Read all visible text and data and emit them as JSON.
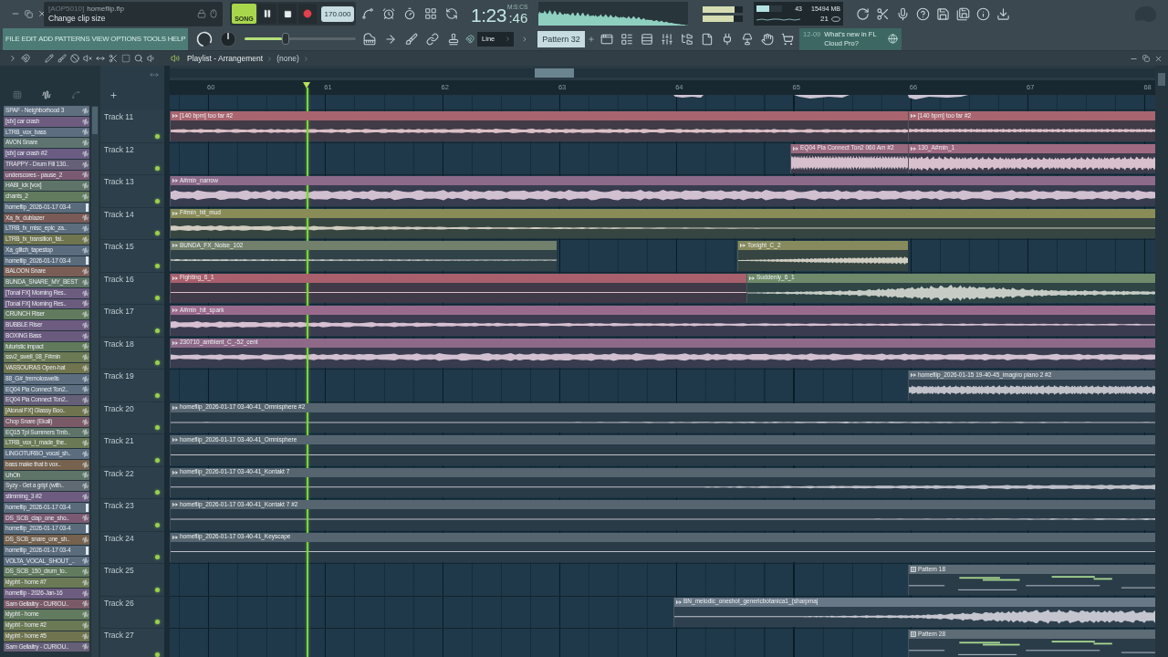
{
  "hint_bar": {
    "tag": "[AOP5010]",
    "file": "homeflip.flp",
    "message": "Change clip size"
  },
  "transport": {
    "mode": "SONG",
    "song_mode": true,
    "playing": true,
    "recording": false,
    "tempo": "170.000"
  },
  "time_display": {
    "main": "1:23",
    "sub": ":46",
    "unit": "M:S:CS"
  },
  "output_meters": [
    {
      "level": 0.8
    },
    {
      "level": 0.78
    }
  ],
  "performance": {
    "cpu": {
      "level": 0.5
    },
    "cpu_reading": "43",
    "memory": "15494 MB",
    "polyphony": "21"
  },
  "menu": [
    "FILE",
    "EDIT",
    "ADD",
    "PATTERNS",
    "VIEW",
    "OPTIONS",
    "TOOLS",
    "HELP"
  ],
  "master_volume": {
    "level": 0.37
  },
  "snap": {
    "value": "Line"
  },
  "pattern_selector": {
    "value": "Pattern 32"
  },
  "news": {
    "date": "12-09",
    "headline": "What's new in FL Cloud Pro?"
  },
  "playlist": {
    "title": "Playlist - Arrangement",
    "arrangement": "(none)",
    "browser_tabs": [
      {
        "kind": "patterns",
        "selected": false
      },
      {
        "kind": "audio",
        "selected": true
      },
      {
        "kind": "automation",
        "selected": false
      }
    ],
    "clip_sources": [
      {
        "name": "SPAF - Neighborhood 3",
        "kind": "audio",
        "color": "#5f6f80"
      },
      {
        "name": "[sfx] car crash",
        "kind": "audio",
        "color": "#6d5c80"
      },
      {
        "name": "LTRB_vox_bass",
        "kind": "audio",
        "color": "#5c6d80"
      },
      {
        "name": "AVON Snare",
        "kind": "audio",
        "color": "#5f7470"
      },
      {
        "name": "[sfx] car crash #2",
        "kind": "audio",
        "color": "#6a5c82"
      },
      {
        "name": "TRAPPY - Drum Fill 130..",
        "kind": "audio",
        "color": "#665f78"
      },
      {
        "name": "underscores - pause_2",
        "kind": "audio",
        "color": "#7a5a72"
      },
      {
        "name": "HABI_ick [vox]",
        "kind": "audio",
        "color": "#5f7468"
      },
      {
        "name": "chants_2",
        "kind": "audio",
        "color": "#627a5e"
      },
      {
        "name": "homeflip_2026-01-17 03-4",
        "kind": "recording",
        "color": "#5a6b7c"
      },
      {
        "name": "Xa_fx_dublazer",
        "kind": "audio",
        "color": "#7a5a56"
      },
      {
        "name": "LTRB_fx_misc_epic_za..",
        "kind": "audio",
        "color": "#5c6d7e"
      },
      {
        "name": "LTRB_fx_transition_fal..",
        "kind": "audio",
        "color": "#70744f"
      },
      {
        "name": "Xa_glitch_tapestop",
        "kind": "audio",
        "color": "#5b6c7f"
      },
      {
        "name": "homeflip_2026-01-17 03-4",
        "kind": "recording",
        "color": "#5a6b7c"
      },
      {
        "name": "BALOON Snare",
        "kind": "audio",
        "color": "#7a5e55"
      },
      {
        "name": "BUNDA_SNARE_MY_BEST",
        "kind": "audio",
        "color": "#5f7466"
      },
      {
        "name": "[Tonal FX] Morning Res..",
        "kind": "audio",
        "color": "#6d5c80"
      },
      {
        "name": "[Tonal FX] Morning Res..",
        "kind": "audio",
        "color": "#6b5c7e"
      },
      {
        "name": "CRUNCH Riser",
        "kind": "audio",
        "color": "#627a5e"
      },
      {
        "name": "BUBBLE Riser",
        "kind": "audio",
        "color": "#6d5c80"
      },
      {
        "name": "BOXING Bass",
        "kind": "audio",
        "color": "#6a5a7e"
      },
      {
        "name": "futuristic impact",
        "kind": "audio",
        "color": "#627a5c"
      },
      {
        "name": "ssv2_swell_08_F#min",
        "kind": "audio",
        "color": "#6b7a55"
      },
      {
        "name": "VASSOURAS Open-hat",
        "kind": "audio",
        "color": "#70744f"
      },
      {
        "name": "88_G#_tremoloswells",
        "kind": "audio",
        "color": "#5c6d80"
      },
      {
        "name": "EQ04 Pia Connect Ton2..",
        "kind": "audio",
        "color": "#5c6d7f"
      },
      {
        "name": "EQ04 Pia Connect Ton2..",
        "kind": "audio",
        "color": "#665f78"
      },
      {
        "name": "[Atonal FX] Glassy Boo..",
        "kind": "audio",
        "color": "#70744e"
      },
      {
        "name": "Chop Snare (Ekali)",
        "kind": "audio",
        "color": "#7a5a66"
      },
      {
        "name": "EQ15 Tpl Summers Tmb..",
        "kind": "audio",
        "color": "#5f7468"
      },
      {
        "name": "LTRB_vox_I_made_the..",
        "kind": "audio",
        "color": "#6b7a55"
      },
      {
        "name": "LINGOTURBO_vocal_sh..",
        "kind": "audio",
        "color": "#5c6d80"
      },
      {
        "name": "bass make that b vox..",
        "kind": "audio",
        "color": "#76624f"
      },
      {
        "name": "UhOh",
        "kind": "audio",
        "color": "#5f7468"
      },
      {
        "name": "Syzy - Get a grip! (with..",
        "kind": "audio",
        "color": "#5f6a72"
      },
      {
        "name": "stimming_3 #2",
        "kind": "audio",
        "color": "#6d5c80"
      },
      {
        "name": "homeflip_2026-01-17 03-4",
        "kind": "recording",
        "color": "#5a6b7c"
      },
      {
        "name": "DS_SCB_clap_one_sho..",
        "kind": "audio",
        "color": "#7a5a72"
      },
      {
        "name": "homeflip_2026-01-17 03-4",
        "kind": "recording",
        "color": "#5a6b7c"
      },
      {
        "name": "DS_SCB_snare_one_sh..",
        "kind": "audio",
        "color": "#76624f"
      },
      {
        "name": "homeflip_2026-01-17 03-4",
        "kind": "recording",
        "color": "#5a6b7c"
      },
      {
        "name": "VOLTA_VOCAL_SHOUT_..",
        "kind": "audio",
        "color": "#5c6d80"
      },
      {
        "name": "DS_SCB_150_drum_to..",
        "kind": "audio",
        "color": "#627a5e"
      },
      {
        "name": "klypht - home #7",
        "kind": "audio",
        "color": "#6b7a55"
      },
      {
        "name": "homeflip - 2026-Jan-16",
        "kind": "audio",
        "color": "#6d5c80"
      },
      {
        "name": "Sam Gellaitry - CURIOU..",
        "kind": "audio",
        "color": "#7a5a66"
      },
      {
        "name": "klypht - home",
        "kind": "audio",
        "color": "#627a5e"
      },
      {
        "name": "klypht - home #2",
        "kind": "audio",
        "color": "#6b7a55"
      },
      {
        "name": "klypht - home #5",
        "kind": "audio",
        "color": "#70744f"
      },
      {
        "name": "Sam Gellaitry - CURIOU..",
        "kind": "audio",
        "color": "#665f78"
      }
    ],
    "ruler": [
      "60",
      "61",
      "62",
      "63",
      "64",
      "65",
      "66",
      "67",
      "68"
    ],
    "playhead": {
      "level": 0.139
    },
    "tracks": [
      {
        "name": "Track 11",
        "enabled": true,
        "clips": [
          {
            "name": "[140 bpm] too far #2",
            "kind": "audio",
            "color": "#a8656f"
          },
          {
            "name": "[140 bpm] too far #2",
            "kind": "audio",
            "color": "#a8656f"
          }
        ]
      },
      {
        "name": "Track 12",
        "enabled": true,
        "clips": [
          {
            "name": "EQ04 Pia Connect Ton2 060 Am #2",
            "kind": "audio",
            "color": "#9a6a80"
          },
          {
            "name": "130_A#min_1",
            "kind": "audio",
            "color": "#a06a82"
          }
        ]
      },
      {
        "name": "Track 13",
        "enabled": true,
        "clips": [
          {
            "name": "A#min_narrow",
            "kind": "audio",
            "color": "#8c6a8a"
          }
        ]
      },
      {
        "name": "Track 14",
        "enabled": true,
        "clips": [
          {
            "name": "F#min_hit_mud",
            "kind": "audio",
            "color": "#8a8c58"
          }
        ]
      },
      {
        "name": "Track 15",
        "enabled": true,
        "clips": [
          {
            "name": "BUNDA_FX_Noise_102",
            "kind": "audio",
            "color": "#72806c"
          },
          {
            "name": "Tonight_C_2",
            "kind": "audio",
            "color": "#868a5c"
          }
        ]
      },
      {
        "name": "Track 16",
        "enabled": true,
        "clips": [
          {
            "name": "Fighting_6_1",
            "kind": "audio",
            "color": "#a8606c"
          },
          {
            "name": "Suddenly_6_1",
            "kind": "audio",
            "color": "#6e8a6a"
          }
        ]
      },
      {
        "name": "Track 17",
        "enabled": true,
        "clips": [
          {
            "name": "A#min_hit_spark",
            "kind": "audio",
            "color": "#9a6a8c"
          }
        ]
      },
      {
        "name": "Track 18",
        "enabled": true,
        "clips": [
          {
            "name": "230710_ambient_C_-52_cent",
            "kind": "audio",
            "color": "#8e6a88"
          }
        ]
      },
      {
        "name": "Track 19",
        "enabled": true,
        "clips": [
          {
            "name": "homeflip_2026-01-15 19-40-45_imagiro piano 2 #2",
            "kind": "audio",
            "color": "#5e6c78"
          }
        ]
      },
      {
        "name": "Track 20",
        "enabled": true,
        "clips": [
          {
            "name": "homeflip_2026-01-17 03-40-41_Omnisphere #2",
            "kind": "audio",
            "color": "#56656f"
          }
        ]
      },
      {
        "name": "Track 21",
        "enabled": true,
        "clips": [
          {
            "name": "homeflip_2026-01-17 03-40-41_Omnisphere",
            "kind": "audio",
            "color": "#56656f"
          }
        ]
      },
      {
        "name": "Track 22",
        "enabled": true,
        "clips": [
          {
            "name": "homeflip_2026-01-17 03-40-41_Kontakt 7",
            "kind": "audio",
            "color": "#56656f"
          }
        ]
      },
      {
        "name": "Track 23",
        "enabled": true,
        "clips": [
          {
            "name": "homeflip_2026-01-17 03-40-41_Kontakt 7 #2",
            "kind": "audio",
            "color": "#56656f"
          }
        ]
      },
      {
        "name": "Track 24",
        "enabled": true,
        "clips": [
          {
            "name": "homeflip_2026-01-17 03-40-41_Keyscape",
            "kind": "audio",
            "color": "#56656f"
          }
        ]
      },
      {
        "name": "Track 25",
        "enabled": true,
        "clips": [
          {
            "name": "Pattern 18",
            "kind": "pattern",
            "color": "#5e6c76"
          }
        ]
      },
      {
        "name": "Track 26",
        "enabled": true,
        "clips": [
          {
            "name": "BN_melodic_oneshot_genericbotanica1_(sharpmaj",
            "kind": "audio",
            "color": "#687886"
          }
        ]
      },
      {
        "name": "Track 27",
        "enabled": true,
        "clips": [
          {
            "name": "Pattern 28",
            "kind": "pattern",
            "color": "#5e6c76"
          }
        ]
      }
    ]
  }
}
